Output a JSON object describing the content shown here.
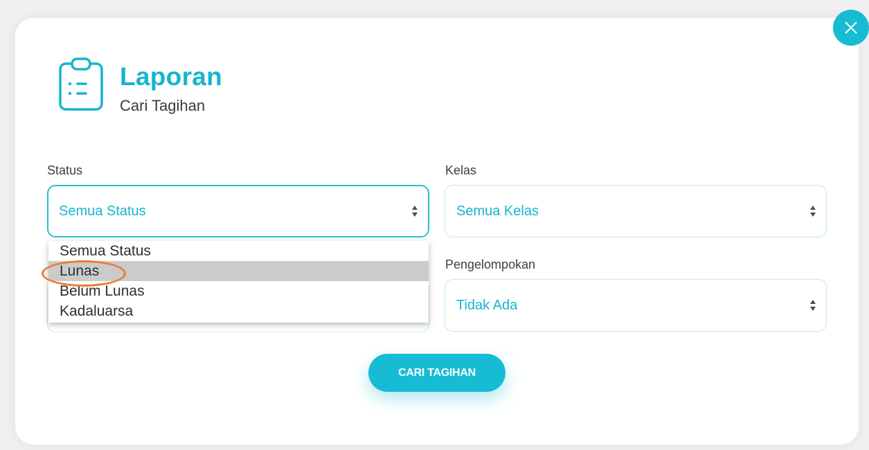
{
  "header": {
    "title": "Laporan",
    "subtitle": "Cari Tagihan",
    "icon": "clipboard-list-icon"
  },
  "filters": {
    "status": {
      "label": "Status",
      "value": "Semua Status",
      "options": [
        "Semua Status",
        "Lunas",
        "Belum Lunas",
        "Kadaluarsa"
      ],
      "highlighted_option": "Lunas"
    },
    "kelas": {
      "label": "Kelas",
      "value": "Semua Kelas"
    },
    "pengelompokan": {
      "label": "Pengelompokan",
      "value": "Tidak Ada"
    }
  },
  "actions": {
    "search_label": "CARI TAGIHAN"
  },
  "colors": {
    "accent": "#17bcd4",
    "highlight": "#f07a2e"
  }
}
